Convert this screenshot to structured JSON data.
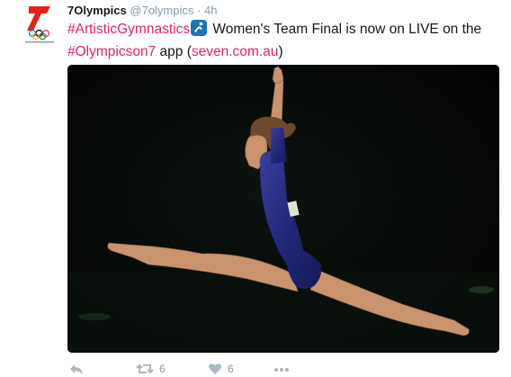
{
  "tweet": {
    "display_name": "7Olympics",
    "handle": "@7olympics",
    "separator": "·",
    "time": "4h",
    "hashtag_sport": "#ArtisticGymnastics",
    "text_main": " Women's Team Final is now on LIVE on the",
    "hashtag_app": "#Olympicson7",
    "text_app": " app (",
    "link": "seven.com.au",
    "text_close": ")"
  },
  "actions": {
    "retweet_count": "6",
    "like_count": "6"
  },
  "colors": {
    "accent": "#e0245e",
    "muted": "#8899a6",
    "seven_red": "#e2231a",
    "sport_emoji_blue": "#1d74b5"
  },
  "icons": {
    "avatar": "7olympics-logo",
    "sport_emoji": "gymnastics-emoji",
    "reply": "reply-icon",
    "retweet": "retweet-icon",
    "like": "heart-icon",
    "more": "more-icon"
  }
}
